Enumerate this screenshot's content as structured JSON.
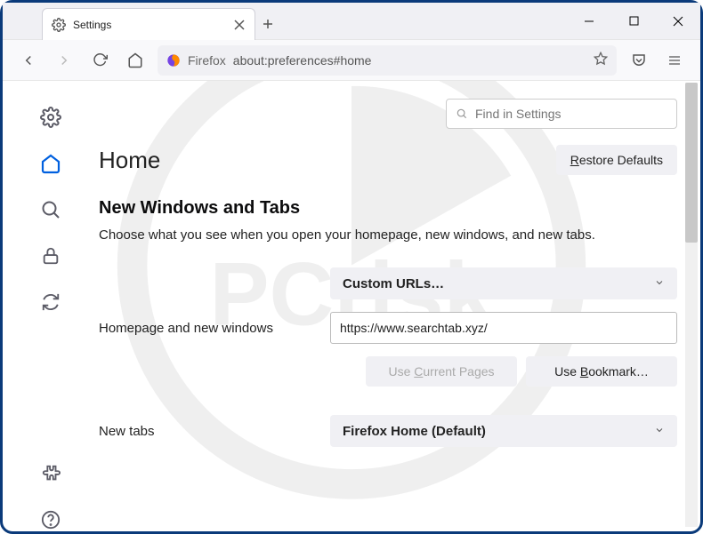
{
  "tab": {
    "title": "Settings"
  },
  "urlbar": {
    "identity": "Firefox",
    "url": "about:preferences#home"
  },
  "search": {
    "placeholder": "Find in Settings"
  },
  "page": {
    "title": "Home",
    "restore_label": "Restore Defaults",
    "section_heading": "New Windows and Tabs",
    "section_desc": "Choose what you see when you open your homepage, new windows, and new tabs."
  },
  "homepage": {
    "label": "Homepage and new windows",
    "dropdown_value": "Custom URLs…",
    "url_value": "https://www.searchtab.xyz/",
    "use_current_label": "Use Current Pages",
    "use_bookmark_label": "Use Bookmark…"
  },
  "newtabs": {
    "label": "New tabs",
    "dropdown_value": "Firefox Home (Default)"
  }
}
